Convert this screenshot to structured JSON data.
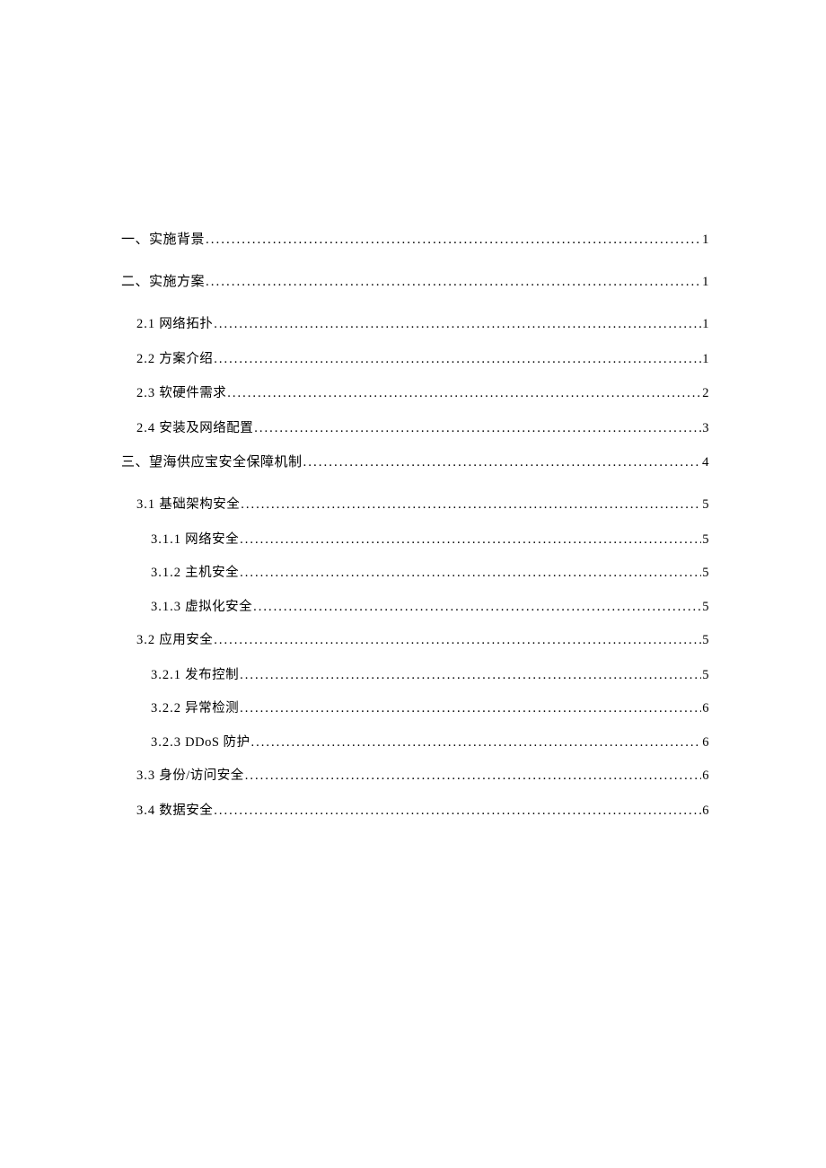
{
  "toc": [
    {
      "level": 1,
      "label": "一、实施背景",
      "page": "1"
    },
    {
      "level": 1,
      "label": "二、实施方案",
      "page": "1"
    },
    {
      "level": 2,
      "num": "2.1",
      "label": " 网络拓扑",
      "page": "1"
    },
    {
      "level": 2,
      "num": "2.2",
      "label": " 方案介绍",
      "page": "1"
    },
    {
      "level": 2,
      "num": "2.3",
      "label": " 软硬件需求",
      "page": "2"
    },
    {
      "level": 2,
      "num": "2.4",
      "label": " 安装及网络配置",
      "page": "3"
    },
    {
      "level": 1,
      "label": "三、望海供应宝安全保障机制",
      "page": "4"
    },
    {
      "level": 2,
      "num": "3.1",
      "label": " 基础架构安全",
      "page": "5"
    },
    {
      "level": 3,
      "num": "3.1.1",
      "label": " 网络安全 ",
      "page": "5"
    },
    {
      "level": 3,
      "num": "3.1.2",
      "label": " 主机安全 ",
      "page": "5"
    },
    {
      "level": 3,
      "num": "3.1.3",
      "label": " 虚拟化安全 ",
      "page": "5"
    },
    {
      "level": 2,
      "num": "3.2",
      "label": " 应用安全",
      "page": "5"
    },
    {
      "level": 3,
      "num": "3.2.1",
      "label": " 发布控制 ",
      "page": "5"
    },
    {
      "level": 3,
      "num": "3.2.2",
      "label": " 异常检测 ",
      "page": "6"
    },
    {
      "level": 3,
      "num": "3.2.3",
      "label": " DDoS 防护",
      "page": "6"
    },
    {
      "level": 2,
      "num": "3.3",
      "label": " 身份/访问安全",
      "page": "6"
    },
    {
      "level": 2,
      "num": "3.4",
      "label": " 数据安全",
      "page": "6"
    }
  ]
}
